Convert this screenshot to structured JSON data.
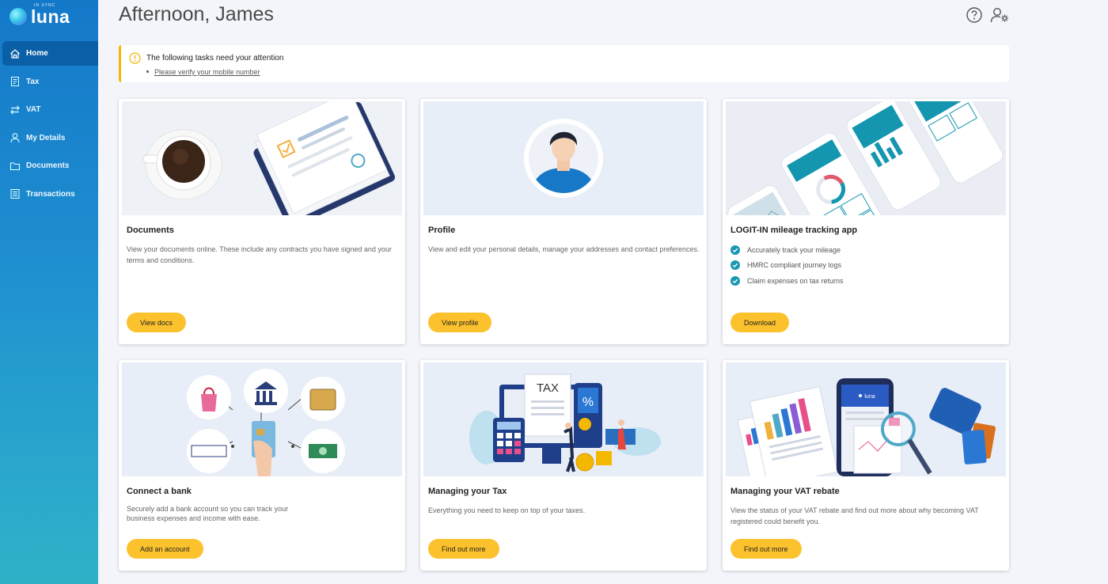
{
  "brand": {
    "name": "luna",
    "tag": "IN SYNC"
  },
  "nav": [
    {
      "label": "Home",
      "icon": "home-icon",
      "active": true
    },
    {
      "label": "Tax",
      "icon": "receipt-icon",
      "active": false
    },
    {
      "label": "VAT",
      "icon": "arrows-swap-icon",
      "active": false
    },
    {
      "label": "My Details",
      "icon": "user-icon",
      "active": false
    },
    {
      "label": "Documents",
      "icon": "folder-icon",
      "active": false
    },
    {
      "label": "Transactions",
      "icon": "list-icon",
      "active": false
    }
  ],
  "header": {
    "greeting": "Afternoon, James",
    "help_icon": "help-icon",
    "settings_icon": "user-settings-icon"
  },
  "alert": {
    "title": "The following tasks need your attention",
    "link": "Please verify your mobile number",
    "icon": "warning-icon"
  },
  "cards": [
    {
      "title": "Documents",
      "desc": "View your documents online. These include any contracts you have signed and your terms and conditions.",
      "button": "View docs"
    },
    {
      "title": "Profile",
      "desc": "View and edit your personal details, manage your addresses and contact preferences.",
      "button": "View profile"
    },
    {
      "title": "LOGIT-IN mileage tracking app",
      "checks": [
        "Accurately track your mileage",
        "HMRC compliant journey logs",
        "Claim expenses on tax returns"
      ],
      "button": "Download"
    },
    {
      "title": "Connect a bank",
      "desc": "Securely add a bank account so you can track your business expenses and income with ease.",
      "button": "Add an account"
    },
    {
      "title": "Managing your Tax",
      "desc": "Everything you need to keep on top of your taxes.",
      "button": "Find out more",
      "illustration_text": "TAX"
    },
    {
      "title": "Managing your VAT rebate",
      "desc": "View the status of your VAT rebate and find out more about why becoming VAT registered could benefit you.",
      "button": "Find out more",
      "illustration_text": "luna"
    }
  ],
  "colors": {
    "accent": "#fcc22d",
    "sidebar_top": "#1478c9",
    "sidebar_bottom": "#2fb2c8",
    "check": "#1a97b4",
    "alert_border": "#f5b800"
  }
}
